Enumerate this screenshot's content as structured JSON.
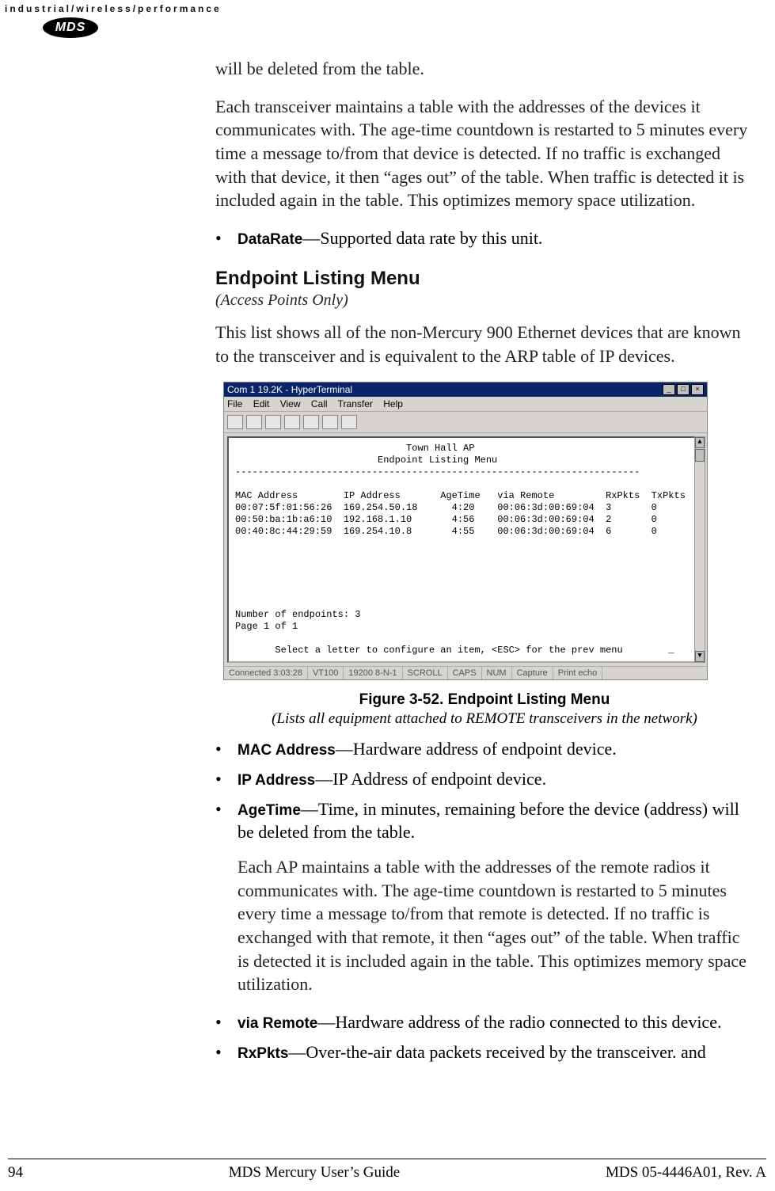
{
  "header": {
    "tagline": "industrial/wireless/performance",
    "logo_text": "MDS"
  },
  "body": {
    "p1": "will be deleted from the table.",
    "p2": "Each transceiver maintains a table with the addresses of the devices it communicates with. The age-time countdown is restarted to 5 minutes every time a message to/from that device is detected. If no traffic is exchanged with that device, it then “ages out” of the table. When traffic is detected it is included again in the table. This optimizes memory space utilization.",
    "bullet_datarate_term": "DataRate",
    "bullet_datarate_desc": "—Supported data rate by this unit.",
    "h2": "Endpoint Listing Menu",
    "h2_sub": "(Access Points Only)",
    "p3": "This list shows all of the non-Mercury 900 Ethernet devices that are known to the transceiver and is equivalent to the ARP table of IP devices.",
    "figcaption": "Figure 3-52. Endpoint Listing Menu",
    "figsub": "(Lists all equipment attached to REMOTE transceivers in the network)",
    "bullets2": [
      {
        "term": "MAC Address",
        "desc": "—Hardware address of endpoint device."
      },
      {
        "term": "IP Address",
        "desc": "—IP Address of endpoint device."
      },
      {
        "term": "AgeTime",
        "desc": "—Time, in minutes, remaining before the device (address) will be deleted from the table."
      }
    ],
    "p4": "Each AP maintains a table with the addresses of the remote radios it communicates with. The age-time countdown is restarted to 5 minutes every time a message to/from that remote is detected. If no traffic is exchanged with that remote, it then “ages out” of the table. When traffic is detected it is included again in the table. This optimizes memory space utilization.",
    "bullets3": [
      {
        "term": "via Remote",
        "desc": "—Hardware address of the radio connected to this device."
      },
      {
        "term": "RxPkts",
        "desc": "—Over-the-air data packets received by the transceiver. and"
      }
    ]
  },
  "terminal": {
    "title": "Com 1 19.2K - HyperTerminal",
    "menu": [
      "File",
      "Edit",
      "View",
      "Call",
      "Transfer",
      "Help"
    ],
    "content_lines": [
      "                              Town Hall AP",
      "                         Endpoint Listing Menu",
      "-----------------------------------------------------------------------",
      "",
      "MAC Address        IP Address       AgeTime   via Remote         RxPkts  TxPkts",
      "00:07:5f:01:56:26  169.254.50.18      4:20    00:06:3d:00:69:04  3       0",
      "00:50:ba:1b:a6:10  192.168.1.10       4:56    00:06:3d:00:69:04  2       0",
      "00:40:8c:44:29:59  169.254.10.8       4:55    00:06:3d:00:69:04  6       0",
      "",
      "",
      "",
      "",
      "",
      "",
      "Number of endpoints: 3",
      "Page 1 of 1",
      "",
      "       Select a letter to configure an item, <ESC> for the prev menu        _"
    ],
    "status": {
      "connected": "Connected 3:03:28",
      "emul": "VT100",
      "port": "19200 8-N-1",
      "s1": "SCROLL",
      "s2": "CAPS",
      "s3": "NUM",
      "s4": "Capture",
      "s5": "Print echo"
    },
    "endpoint_table": {
      "columns": [
        "MAC Address",
        "IP Address",
        "AgeTime",
        "via Remote",
        "RxPkts",
        "TxPkts"
      ],
      "rows": [
        {
          "mac": "00:07:5f:01:56:26",
          "ip": "169.254.50.18",
          "age": "4:20",
          "via": "00:06:3d:00:69:04",
          "rx": 3,
          "tx": 0
        },
        {
          "mac": "00:50:ba:1b:a6:10",
          "ip": "192.168.1.10",
          "age": "4:56",
          "via": "00:06:3d:00:69:04",
          "rx": 2,
          "tx": 0
        },
        {
          "mac": "00:40:8c:44:29:59",
          "ip": "169.254.10.8",
          "age": "4:55",
          "via": "00:06:3d:00:69:04",
          "rx": 6,
          "tx": 0
        }
      ],
      "endpoint_count": 3,
      "page": "Page 1 of 1",
      "hint": "Select a letter to configure an item, <ESC> for the prev menu",
      "ap_name": "Town Hall AP",
      "menu_name": "Endpoint Listing Menu"
    }
  },
  "footer": {
    "page_no": "94",
    "center": "MDS Mercury User’s Guide",
    "right": "MDS 05-4446A01, Rev. A"
  }
}
